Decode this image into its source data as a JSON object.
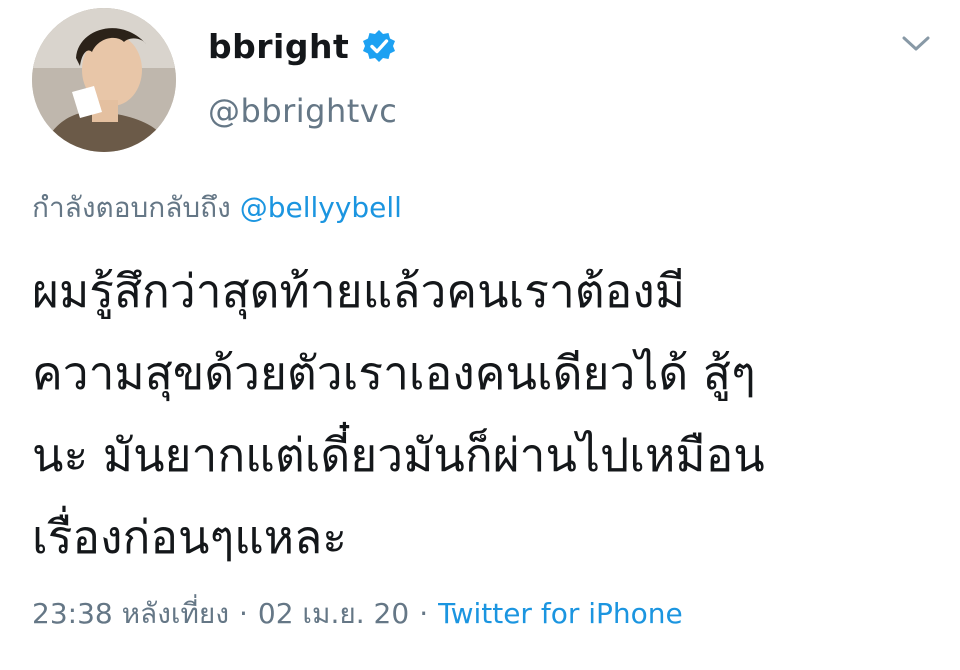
{
  "user": {
    "display_name": "bbright",
    "handle": "@bbrightvc",
    "verified": true,
    "verified_icon": "verified-badge-icon",
    "avatar_icon": "user-avatar"
  },
  "menu": {
    "icon": "chevron-down-icon"
  },
  "reply": {
    "prefix": "กำลังตอบกลับถึง",
    "mention": "@bellyybell"
  },
  "tweet": {
    "lines": [
      "ผมรู้สึกว่าสุดท้ายแล้วคนเราต้องมี",
      "ความสุขด้วยตัวเราเองคนเดียวได้ สู้ๆ",
      "นะ มันยากแต่เดี๋ยวมันก็ผ่านไปเหมือน",
      "เรื่องก่อนๆแหละ"
    ]
  },
  "meta": {
    "time": "23:38 หลังเที่ยง",
    "separator": "·",
    "date": "02 เม.ย. 20",
    "source": "Twitter for iPhone"
  },
  "colors": {
    "link_blue": "#1b95e0",
    "muted_gray": "#657786",
    "text_dark": "#14171a"
  }
}
